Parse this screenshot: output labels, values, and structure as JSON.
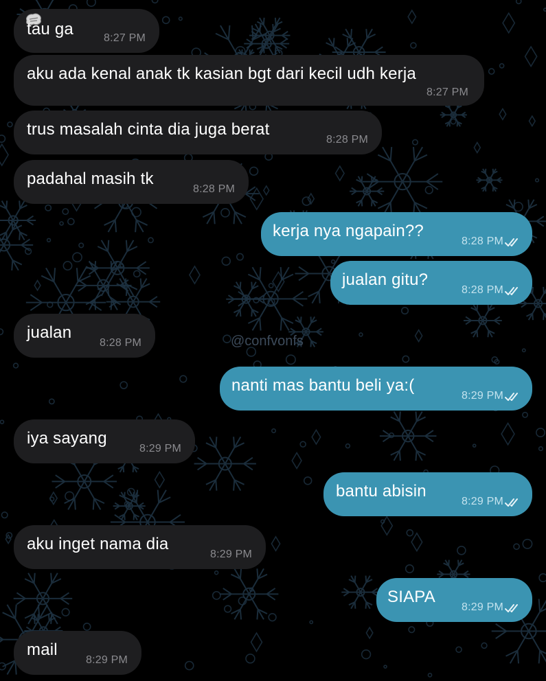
{
  "watermark": "@confvonfs",
  "colors": {
    "background": "#000000",
    "incoming_bubble": "#1e1e20",
    "outgoing_bubble": "#3b94b2",
    "wallpaper_doodle": "#1e3242"
  },
  "icons": {
    "read_receipt": "double-check-icon",
    "sender_avatar": "sticker-icon"
  },
  "messages": [
    {
      "dir": "in",
      "text": "tau ga",
      "time": "8:27 PM"
    },
    {
      "dir": "in",
      "text": "aku ada kenal anak tk kasian bgt dari kecil udh kerja",
      "time": "8:27 PM"
    },
    {
      "dir": "in",
      "text": "trus masalah cinta dia juga berat",
      "time": "8:28 PM"
    },
    {
      "dir": "in",
      "text": "padahal masih tk",
      "time": "8:28 PM"
    },
    {
      "dir": "out",
      "text": "kerja nya ngapain??",
      "time": "8:28 PM",
      "read": true
    },
    {
      "dir": "out",
      "text": "jualan gitu?",
      "time": "8:28 PM",
      "read": true
    },
    {
      "dir": "in",
      "text": "jualan",
      "time": "8:28 PM"
    },
    {
      "dir": "out",
      "text": "nanti mas bantu beli ya:(",
      "time": "8:29 PM",
      "read": true
    },
    {
      "dir": "in",
      "text": "iya sayang",
      "time": "8:29 PM"
    },
    {
      "dir": "out",
      "text": "bantu abisin",
      "time": "8:29 PM",
      "read": true
    },
    {
      "dir": "in",
      "text": "aku inget nama dia",
      "time": "8:29 PM"
    },
    {
      "dir": "out",
      "text": "SIAPA",
      "time": "8:29 PM",
      "read": true
    },
    {
      "dir": "in",
      "text": "mail",
      "time": "8:29 PM"
    }
  ]
}
